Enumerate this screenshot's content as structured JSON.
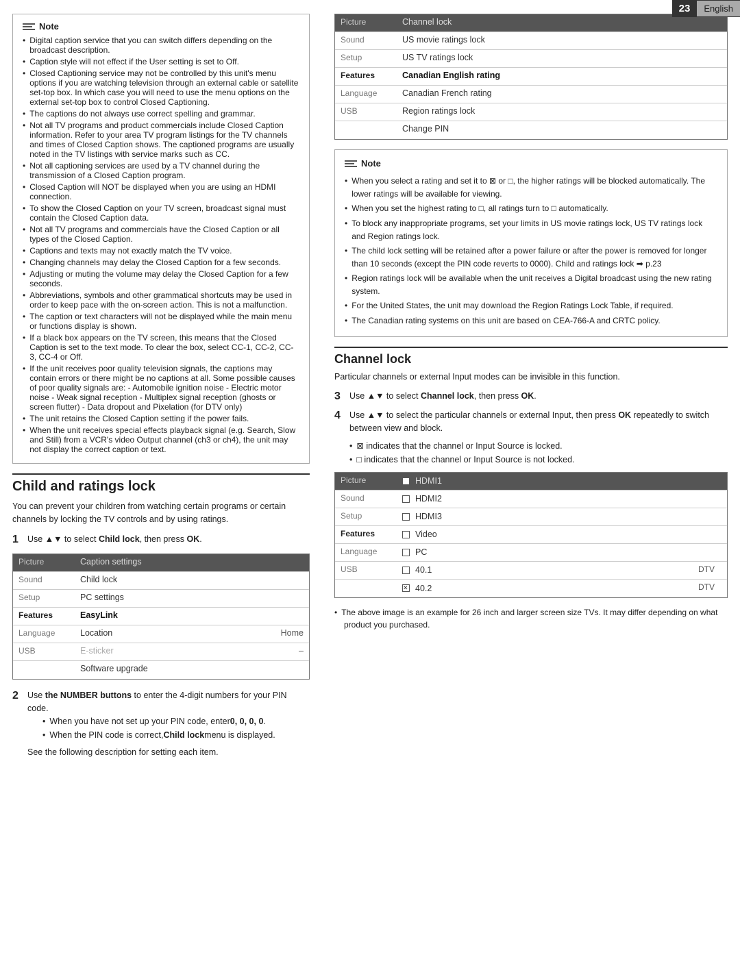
{
  "topbar": {
    "page_number": "23",
    "language": "English"
  },
  "left": {
    "note_header": "Note",
    "note_bullets": [
      "Digital caption service that you can switch differs depending on the broadcast description.",
      "Caption style will not effect if the User setting is set to Off.",
      "Closed Captioning service may not be controlled by this unit's menu options if you are watching television through an external cable or satellite set-top box. In which case you will need to use the menu options on the external set-top box to control Closed Captioning.",
      "The captions do not always use correct spelling and grammar.",
      "Not all TV programs and product commercials include Closed Caption information. Refer to your area TV program listings for the TV channels and times of Closed Caption shows. The captioned programs are usually noted in the TV listings with service marks such as CC.",
      "Not all captioning services are used by a TV channel during the transmission of a Closed Caption program.",
      "Closed Caption will NOT be displayed when you are using an HDMI connection.",
      "To show the Closed Caption on your TV screen, broadcast signal must contain the Closed Caption data.",
      "Not all TV programs and commercials have the Closed Caption or all types of the Closed Caption.",
      "Captions and texts may not exactly match the TV voice.",
      "Changing channels may delay the Closed Caption for a few seconds.",
      "Adjusting or muting the volume may delay the Closed Caption for a few seconds.",
      "Abbreviations, symbols and other grammatical shortcuts may be used in order to keep pace with the on-screen action. This is not a malfunction.",
      "The caption or text characters will not be displayed while the main menu or functions display is shown.",
      "If a black box appears on the TV screen, this means that the Closed Caption is set to the text mode. To clear the box, select CC-1, CC-2, CC-3, CC-4 or Off.",
      "If the unit receives poor quality television signals, the captions may contain errors or there might be no captions at all. Some possible causes of poor quality signals are: - Automobile ignition noise - Electric motor noise - Weak signal reception - Multiplex signal reception (ghosts or screen flutter) - Data dropout and Pixelation (for DTV only)",
      "The unit retains the Closed Caption setting if the power fails.",
      "When the unit receives special effects playback signal (e.g. Search, Slow and Still) from a VCR's video Output channel (ch3 or ch4), the unit may not display the correct caption or text."
    ],
    "section_heading": "Child and ratings lock",
    "section_body": "You can prevent your children from watching certain programs or certain channels by locking the TV controls and by using ratings.",
    "step1_label": "1",
    "step1_text": "Use ▲▼ to select Child lock, then press OK.",
    "menu": {
      "rows": [
        {
          "cat": "Picture",
          "item": "Caption settings",
          "extra": "",
          "cat_active": false,
          "item_active": false,
          "item_disabled": false
        },
        {
          "cat": "Sound",
          "item": "Child lock",
          "extra": "",
          "cat_active": false,
          "item_active": false,
          "item_disabled": false
        },
        {
          "cat": "Setup",
          "item": "PC settings",
          "extra": "",
          "cat_active": false,
          "item_active": false,
          "item_disabled": false
        },
        {
          "cat": "Features",
          "item": "EasyLink",
          "extra": "",
          "cat_active": true,
          "item_active": false,
          "item_disabled": false
        },
        {
          "cat": "Language",
          "item": "Location",
          "extra": "Home",
          "cat_active": false,
          "item_active": false,
          "item_disabled": false
        },
        {
          "cat": "USB",
          "item": "E-sticker",
          "extra": "–",
          "cat_active": false,
          "item_active": false,
          "item_disabled": true
        },
        {
          "cat": "",
          "item": "Software upgrade",
          "extra": "",
          "cat_active": false,
          "item_active": false,
          "item_disabled": false
        }
      ]
    },
    "step2_label": "2",
    "step2_text": "Use the NUMBER buttons to enter the 4-digit numbers for your PIN code.",
    "step2_sub": [
      "When you have not set up your PIN code, enter 0, 0, 0, 0.",
      "When the PIN code is correct, Child lock menu is displayed."
    ],
    "step2_followup": "See the following description for setting each item."
  },
  "right": {
    "menu_header_cat": "Picture",
    "menu_header_item": "Channel lock",
    "menu_rows": [
      {
        "cat": "Sound",
        "item": "US movie ratings lock",
        "cat_active": false,
        "item_active": false
      },
      {
        "cat": "Setup",
        "item": "US TV ratings lock",
        "cat_active": false,
        "item_active": false
      },
      {
        "cat": "Features",
        "item": "Canadian English rating",
        "cat_active": true,
        "item_active": false
      },
      {
        "cat": "Language",
        "item": "Canadian French rating",
        "cat_active": false,
        "item_active": false
      },
      {
        "cat": "USB",
        "item": "Region ratings lock",
        "cat_active": false,
        "item_active": false
      },
      {
        "cat": "",
        "item": "Change PIN",
        "cat_active": false,
        "item_active": false
      }
    ],
    "note_header": "Note",
    "note_bullets": [
      "When you select a rating and set it to ⊠ or □, the higher ratings will be blocked automatically. The lower ratings will be available for viewing.",
      "When you set the highest rating to □, all ratings turn to □ automatically.",
      "To block any inappropriate programs, set your limits in US movie ratings lock, US TV ratings lock and Region ratings lock.",
      "The child lock setting will be retained after a power failure or after the power is removed for longer than 10 seconds (except the PIN code reverts to 0000). Child and ratings lock ➡ p.23",
      "Region ratings lock will be available when the unit receives a Digital broadcast using the new rating system.",
      "For the United States, the unit may download the Region Ratings Lock Table, if required.",
      "The Canadian rating systems on this unit are based on CEA-766-A and CRTC policy."
    ],
    "channel_heading": "Channel lock",
    "channel_body": "Particular channels or external Input modes can be invisible in this function.",
    "ch_step3_label": "3",
    "ch_step3_text": "Use ▲▼ to select Channel lock, then press OK.",
    "ch_step4_label": "4",
    "ch_step4_text": "Use ▲▼ to select the particular channels or external Input, then press OK repeatedly to switch between view and block.",
    "ch_sub_bullets": [
      "⊠ indicates that the channel or Input Source is locked.",
      "□ indicates that the channel or Input Source is not locked."
    ],
    "ch_menu": {
      "header_cat": "Picture",
      "header_item": "□  HDMI1",
      "rows": [
        {
          "cat": "Sound",
          "item": "HDMI2",
          "checked": false,
          "extra": ""
        },
        {
          "cat": "Setup",
          "item": "HDMI3",
          "checked": false,
          "extra": ""
        },
        {
          "cat": "Features",
          "item": "Video",
          "checked": false,
          "extra": ""
        },
        {
          "cat": "Language",
          "item": "PC",
          "checked": false,
          "extra": ""
        },
        {
          "cat": "USB",
          "item": "40.1",
          "checked": false,
          "extra": "DTV"
        },
        {
          "cat": "",
          "item": "40.2",
          "checked": true,
          "extra": "DTV"
        }
      ]
    },
    "footnote": "The above image is an example for 26 inch and larger screen size TVs. It may differ depending on what product you purchased."
  }
}
